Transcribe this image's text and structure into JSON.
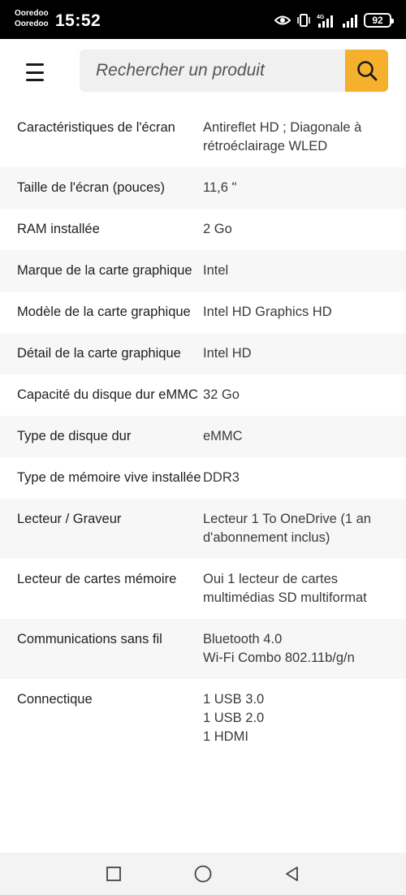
{
  "status_bar": {
    "carrier_1": "Ooredoo",
    "carrier_2": "Ooredoo",
    "time": "15:52",
    "network_label": "4G",
    "battery": "92"
  },
  "header": {
    "search_placeholder": "Rechercher un produit",
    "accent_color": "#f5b12d"
  },
  "specs": [
    {
      "label": "Caractéristiques de l'écran",
      "value": "Antireflet HD ; Diagonale à rétroéclairage WLED"
    },
    {
      "label": "Taille de l'écran (pouces)",
      "value": "11,6 \""
    },
    {
      "label": "RAM installée",
      "value": "2 Go"
    },
    {
      "label": "Marque de la carte graphique",
      "value": "Intel"
    },
    {
      "label": "Modèle de la carte graphique",
      "value": "Intel HD Graphics HD"
    },
    {
      "label": "Détail de la carte graphique",
      "value": "Intel HD"
    },
    {
      "label": "Capacité du disque dur eMMC",
      "value": "32 Go"
    },
    {
      "label": "Type de disque dur",
      "value": "eMMC"
    },
    {
      "label": "Type de mémoire vive installée",
      "value": "DDR3"
    },
    {
      "label": "Lecteur / Graveur",
      "value": "Lecteur 1 To OneDrive (1 an d'abonnement inclus)"
    },
    {
      "label": "Lecteur de cartes mémoire",
      "value": "Oui 1 lecteur de cartes multimédias SD multiformat"
    },
    {
      "label": "Communications sans fil",
      "value": "Bluetooth 4.0\nWi-Fi Combo 802.11b/g/n"
    },
    {
      "label": "Connectique",
      "value": "1 USB 3.0\n1 USB 2.0\n1 HDMI"
    }
  ],
  "navigation": {
    "recents_icon": "square-icon",
    "home_icon": "circle-icon",
    "back_icon": "triangle-back-icon"
  }
}
